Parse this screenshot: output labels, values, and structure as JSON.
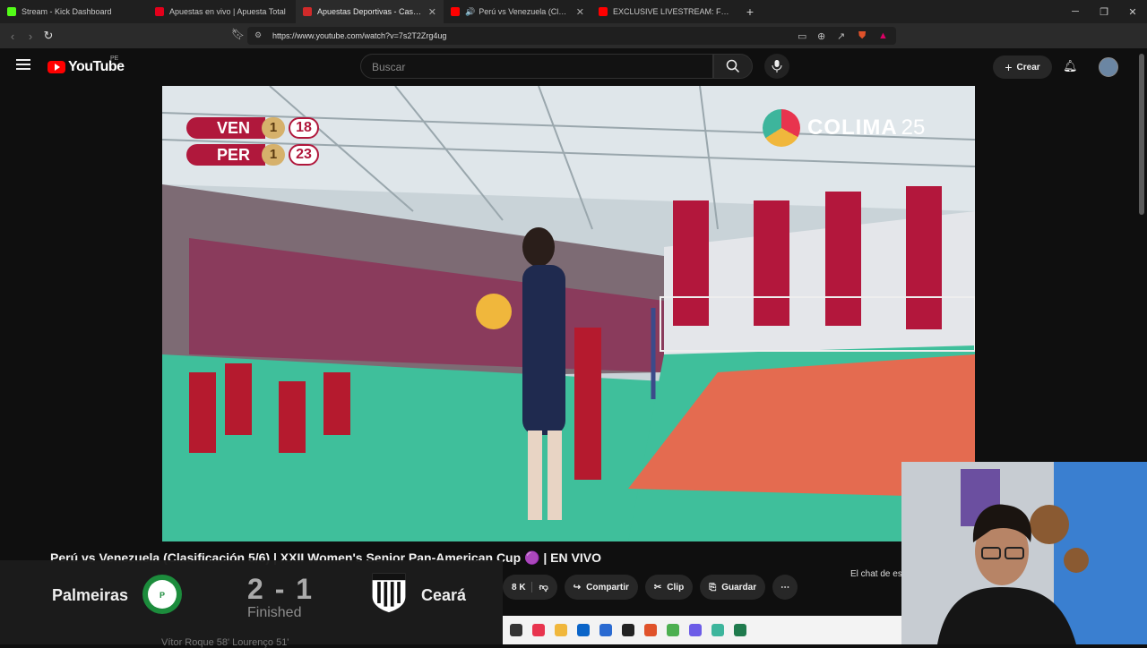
{
  "tabs": [
    {
      "title": "Stream - Kick Dashboard",
      "color": "#53fc18"
    },
    {
      "title": "Apuestas en vivo | Apuesta Total",
      "color": "#e3001b"
    },
    {
      "title": "Apuestas Deportivas - Casa de Apuestas",
      "color": "#d12a2a"
    },
    {
      "title": "Perú vs Venezuela (Clasificación",
      "color": "#ff0000"
    },
    {
      "title": "EXCLUSIVE LIVESTREAM: FC BARC",
      "color": "#ff0000"
    }
  ],
  "address": {
    "url": "https://www.youtube.com/watch?v=7s2T2Zrg4ug"
  },
  "youtube": {
    "logo_text": "YouTube",
    "country": "PE",
    "search_placeholder": "Buscar",
    "create_label": "Crear"
  },
  "video": {
    "scoreboard": {
      "team1": "VEN",
      "team1_sets": "1",
      "team1_points": "18",
      "team2": "PER",
      "team2_sets": "1",
      "team2_points": "23"
    },
    "watermark": "COLIMA",
    "watermark_num": "25"
  },
  "title": "Perú vs Venezuela (Clasificación 5/6) | XXII Women's Senior Pan-American Cup 🟣 | EN VIVO",
  "chat_note": "El chat de es",
  "actions": {
    "likes": "8 K",
    "share": "Compartir",
    "clip": "Clip",
    "save": "Guardar"
  },
  "overlay_match": {
    "home": "Palmeiras",
    "away": "Ceará",
    "score": "2 - 1",
    "status": "Finished",
    "scorers": "Vítor Roque 58'       Lourenço 51'"
  }
}
